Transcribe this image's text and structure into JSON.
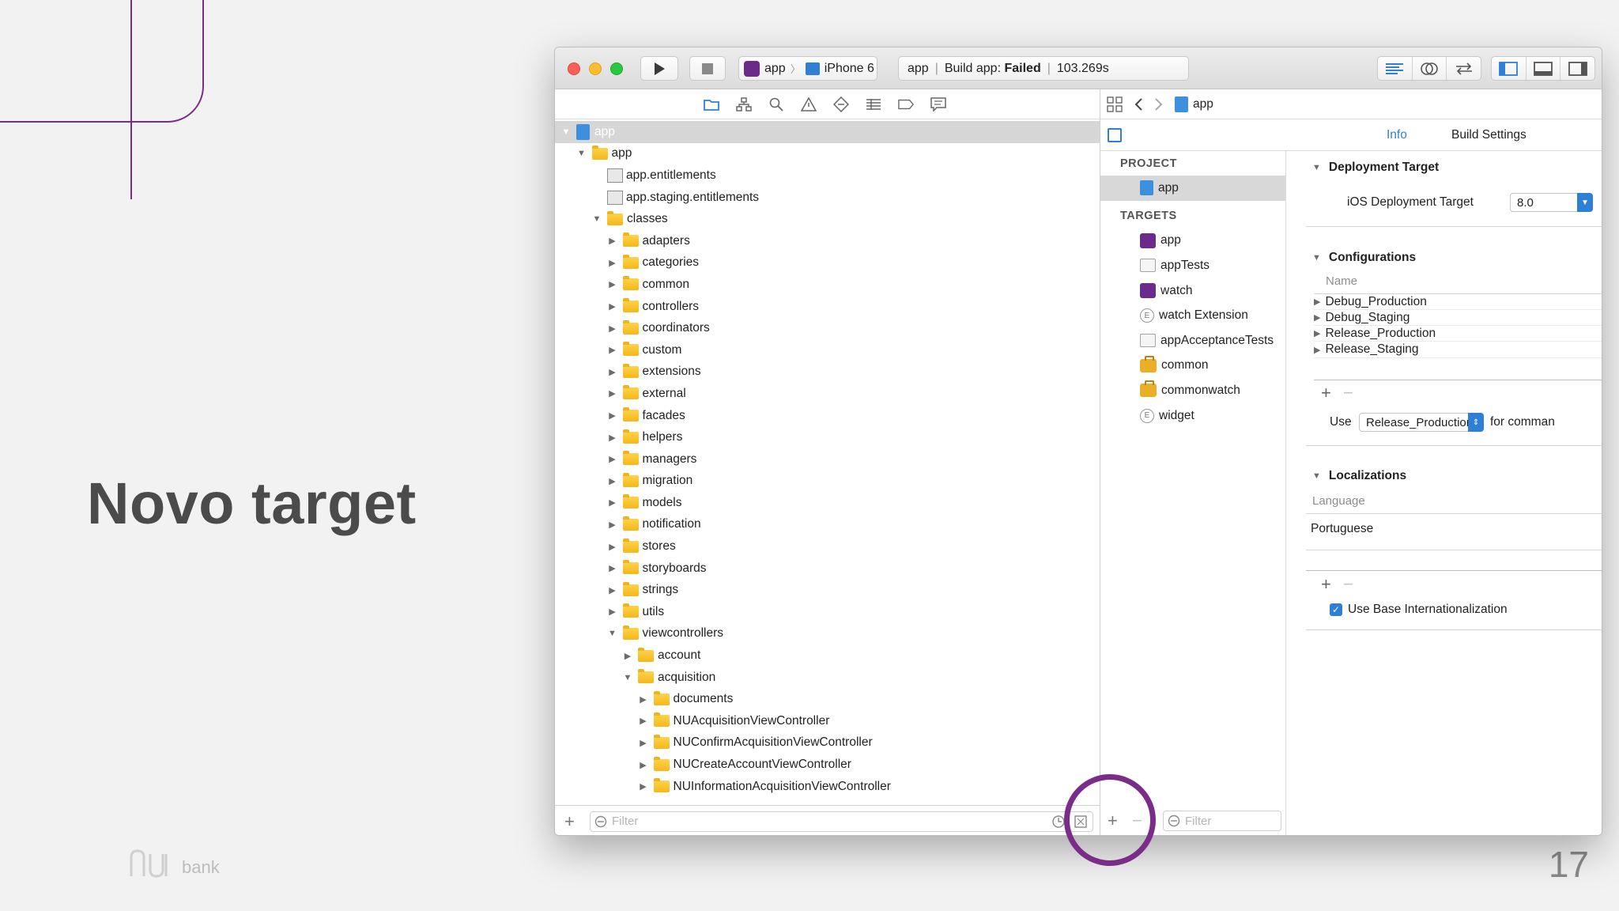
{
  "slide": {
    "title": "Novo target",
    "logo_text": "bank",
    "page_number": "17",
    "accent": "#7a2d88"
  },
  "toolbar": {
    "scheme_app": "app",
    "scheme_sep": "〉",
    "scheme_device": "iPhone 6",
    "status_project": "app",
    "status_label": "Build app:",
    "status_result": "Failed",
    "status_time": "103.269s"
  },
  "navigator": {
    "icons": [
      "folder-icon",
      "hierarchy-icon",
      "search-icon",
      "warning-icon",
      "test-diamond-icon",
      "debug-list-icon",
      "breakpoint-icon",
      "report-icon"
    ],
    "tree": [
      {
        "label": "app",
        "indent": 0,
        "type": "project",
        "expanded": true,
        "root": true
      },
      {
        "label": "app",
        "indent": 1,
        "type": "folder",
        "expanded": true
      },
      {
        "label": "app.entitlements",
        "indent": 2,
        "type": "file"
      },
      {
        "label": "app.staging.entitlements",
        "indent": 2,
        "type": "file"
      },
      {
        "label": "classes",
        "indent": 2,
        "type": "folder",
        "expanded": true
      },
      {
        "label": "adapters",
        "indent": 3,
        "type": "folder"
      },
      {
        "label": "categories",
        "indent": 3,
        "type": "folder"
      },
      {
        "label": "common",
        "indent": 3,
        "type": "folder"
      },
      {
        "label": "controllers",
        "indent": 3,
        "type": "folder"
      },
      {
        "label": "coordinators",
        "indent": 3,
        "type": "folder"
      },
      {
        "label": "custom",
        "indent": 3,
        "type": "folder"
      },
      {
        "label": "extensions",
        "indent": 3,
        "type": "folder"
      },
      {
        "label": "external",
        "indent": 3,
        "type": "folder"
      },
      {
        "label": "facades",
        "indent": 3,
        "type": "folder"
      },
      {
        "label": "helpers",
        "indent": 3,
        "type": "folder"
      },
      {
        "label": "managers",
        "indent": 3,
        "type": "folder"
      },
      {
        "label": "migration",
        "indent": 3,
        "type": "folder"
      },
      {
        "label": "models",
        "indent": 3,
        "type": "folder"
      },
      {
        "label": "notification",
        "indent": 3,
        "type": "folder"
      },
      {
        "label": "stores",
        "indent": 3,
        "type": "folder"
      },
      {
        "label": "storyboards",
        "indent": 3,
        "type": "folder"
      },
      {
        "label": "strings",
        "indent": 3,
        "type": "folder"
      },
      {
        "label": "utils",
        "indent": 3,
        "type": "folder"
      },
      {
        "label": "viewcontrollers",
        "indent": 3,
        "type": "folder",
        "expanded": true
      },
      {
        "label": "account",
        "indent": 4,
        "type": "folder"
      },
      {
        "label": "acquisition",
        "indent": 4,
        "type": "folder",
        "expanded": true
      },
      {
        "label": "documents",
        "indent": 5,
        "type": "folder"
      },
      {
        "label": "NUAcquisitionViewController",
        "indent": 5,
        "type": "folder"
      },
      {
        "label": "NUConfirmAcquisitionViewController",
        "indent": 5,
        "type": "folder"
      },
      {
        "label": "NUCreateAccountViewController",
        "indent": 5,
        "type": "folder"
      },
      {
        "label": "NUInformationAcquisitionViewController",
        "indent": 5,
        "type": "folder"
      }
    ],
    "filter_placeholder": "Filter"
  },
  "editor": {
    "jump_project": "app",
    "tab_info": "Info",
    "tab_build_settings": "Build Settings",
    "project_header": "PROJECT",
    "project_item": "app",
    "targets_header": "TARGETS",
    "targets": [
      {
        "label": "app",
        "icon": "app"
      },
      {
        "label": "appTests",
        "icon": "test"
      },
      {
        "label": "watch",
        "icon": "app"
      },
      {
        "label": "watch Extension",
        "icon": "ext"
      },
      {
        "label": "appAcceptanceTests",
        "icon": "test"
      },
      {
        "label": "common",
        "icon": "case"
      },
      {
        "label": "commonwatch",
        "icon": "case"
      },
      {
        "label": "widget",
        "icon": "ext"
      }
    ],
    "filter_placeholder": "Filter",
    "deployment_header": "Deployment Target",
    "ios_deployment_label": "iOS Deployment Target",
    "ios_deployment_value": "8.0",
    "configurations_header": "Configurations",
    "configurations_col": "Name",
    "configurations": [
      "Debug_Production",
      "Debug_Staging",
      "Release_Production",
      "Release_Staging"
    ],
    "use_label": "Use",
    "use_value": "Release_Production",
    "use_suffix": "for comman",
    "localizations_header": "Localizations",
    "language_col": "Language",
    "languages": [
      "Portuguese"
    ],
    "base_intl_label": "Use Base Internationalization",
    "base_intl_checked": true
  }
}
